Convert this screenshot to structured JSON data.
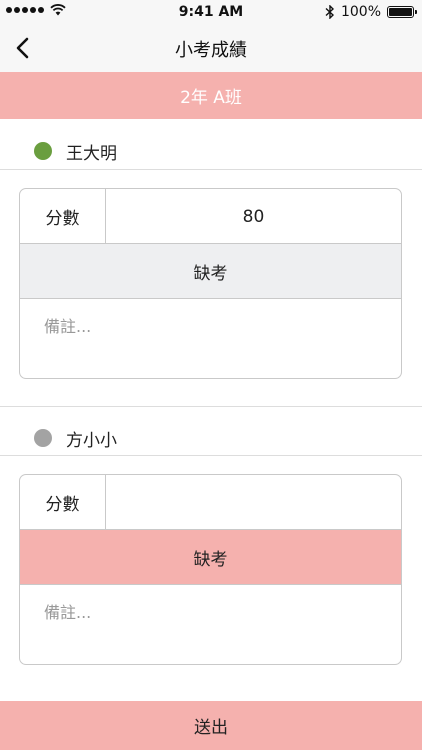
{
  "status_bar": {
    "time": "9:41 AM",
    "battery": "100%",
    "signal_icon": "signal-dots-icon",
    "wifi_icon": "wifi-icon",
    "bluetooth_icon": "bluetooth-icon",
    "battery_icon": "battery-icon"
  },
  "nav": {
    "title": "小考成績",
    "back_icon": "chevron-left-icon"
  },
  "class_banner": "2年 A班",
  "students": [
    {
      "name": "王大明",
      "status_color": "#6a9e3f",
      "score_label": "分數",
      "score_value": "80",
      "absent_label": "缺考",
      "absent_active": false,
      "note_placeholder": "備註..."
    },
    {
      "name": "方小小",
      "status_color": "#a3a3a3",
      "score_label": "分數",
      "score_value": "",
      "absent_label": "缺考",
      "absent_active": true,
      "note_placeholder": "備註..."
    }
  ],
  "submit_label": "送出",
  "colors": {
    "accent": "#f5b1ae",
    "bar_bg": "#f7f7f7",
    "absent_off_bg": "#eeeff1",
    "border": "#c9c9c9"
  }
}
